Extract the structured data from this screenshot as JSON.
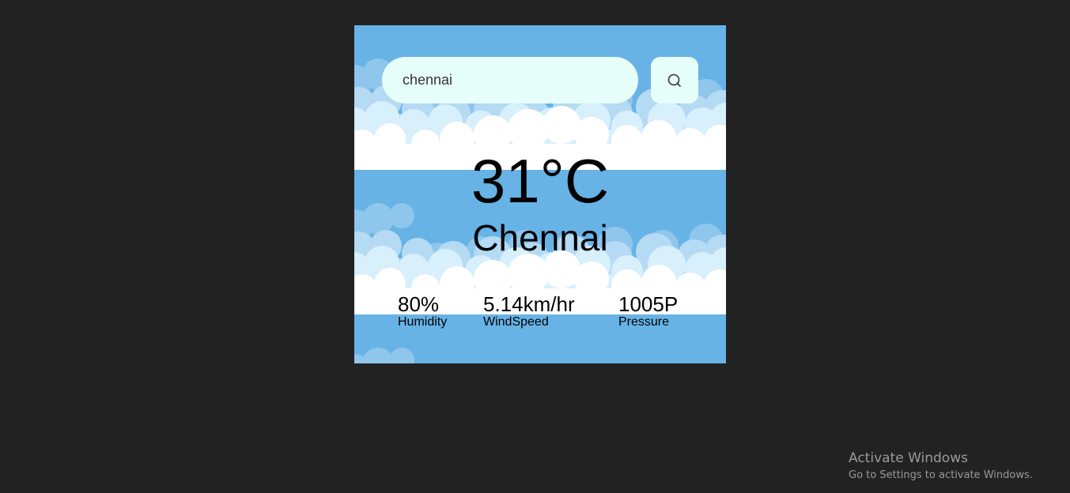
{
  "search": {
    "value": "chennai",
    "icon": "search-icon"
  },
  "weather": {
    "temperature": "31°C",
    "city": "Chennai"
  },
  "details": {
    "humidity_value": "80%",
    "humidity_label": "Humidity",
    "wind_value": "5.14km/hr",
    "wind_label": "WindSpeed",
    "pressure_value": "1005P",
    "pressure_label": "Pressure"
  },
  "watermark": {
    "title": "Activate Windows",
    "subtitle": "Go to Settings to activate Windows."
  },
  "colors": {
    "page_background": "#222222",
    "sky": "#67b3e6",
    "cloud_light": "#d6eefb",
    "cloud_mid": "#a9d3f0",
    "cloud_white": "#ffffff",
    "input_background": "#e6fffb"
  }
}
